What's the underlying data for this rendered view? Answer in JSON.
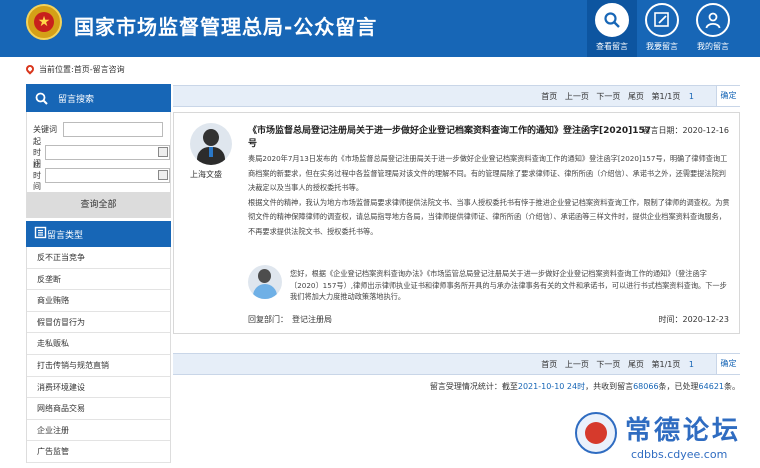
{
  "header": {
    "site_title": "国家市场监督管理总局-公众留言",
    "buttons": [
      {
        "label": "查看留言",
        "icon": "search-icon"
      },
      {
        "label": "我要留言",
        "icon": "edit-icon"
      },
      {
        "label": "我的留言",
        "icon": "user-icon"
      }
    ],
    "brand_color": "#1766b6"
  },
  "breadcrumb": "当前位置:首页-留言咨询",
  "sidebar": {
    "search_title": "留言搜索",
    "fields": {
      "keyword_label": "关键词",
      "start_label": "起时间",
      "end_label": "止时间"
    },
    "query_all": "查询全部",
    "category_title": "留言类型",
    "categories": [
      "反不正当竞争",
      "反垄断",
      "商业贿赂",
      "假冒仿冒行为",
      "走私贩私",
      "打击传销与规范直销",
      "消费环境建设",
      "网络商品交易",
      "企业注册",
      "广告监管"
    ]
  },
  "pager": {
    "first": "首页",
    "prev": "上一页",
    "next": "下一页",
    "last": "尾页",
    "page_info": "第1/1页",
    "page_value": "1",
    "confirm": "确定"
  },
  "message": {
    "author": "上海文盛",
    "title": "《市场监督总局登记注册局关于进一步做好企业登记档案资料查询工作的通知》登注函字[2020]157号",
    "date": "留言日期：2020-12-16",
    "body_1": "奏局2020年7月13日发布的《市场监督总局登记注册局关于进一步做好企业登记档案资料查询工作的通知》登注函字[2020]157号，明确了律师查询工商档案的新要求，但在实务过程中各监督管理局对该文件的理解不同。有的管理局除了要求律师证、律所所函（介绍信）、承诺书之外，还需要提法院判决裁定以及当事人的授权委托书等。",
    "body_2": "根据文件的精神，我认为地方市场监督局要求律师提供法院文书、当事人授权委托书有悖于推进企业登记档案资料查询工作，限制了律师的调查权。为贯彻文件的精神保障律师的调查权，请总局指导地方各局，当律师提供律师证、律所所函（介绍信）、承诺函等三样文件时，提供企业档案资料查询服务，不再要求提供法院文书、授权委托书等。",
    "reply": "您好，根据《企业登记档案资料查询办法》《市场监管总局登记注册局关于进一步做好企业登记档案资料查询工作的通知》（登注函字〔2020〕157号）,律师出示律师执业证书和律师事务所开具的与承办法律事务有关的文件和承诺书，可以进行书式档案资料查询。下一步我们将加大力度推动政策落地执行。",
    "dept_label": "回复部门：",
    "dept_value": "登记注册局",
    "reply_time": "时间：2020-12-23"
  },
  "stats": {
    "prefix": "留言受理情况统计：截至",
    "date": "2021-10-10 24时",
    "mid1": "，共收到留言",
    "received": "68066",
    "mid2": "条，已处理",
    "processed": "64621",
    "suffix": "条。"
  },
  "watermark": {
    "text": "常德论坛",
    "sub": "cdbbs.cdyee.com"
  }
}
